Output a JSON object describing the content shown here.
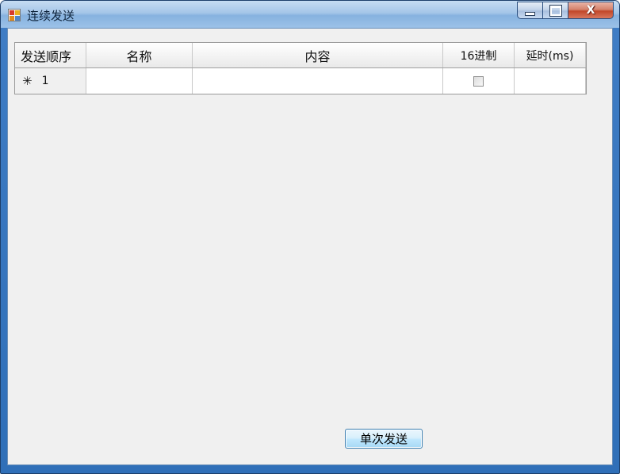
{
  "window": {
    "title": "连续发送"
  },
  "grid": {
    "columns": [
      "发送顺序",
      "名称",
      "内容",
      "16进制",
      "延时(ms)"
    ],
    "rows": [
      {
        "marker": "✳",
        "index": "1",
        "name": "",
        "content": "",
        "hex": false,
        "delay": ""
      }
    ]
  },
  "actions": {
    "single_send_label": "单次发送"
  },
  "colors": {
    "title_bar": "#a4c5e8",
    "client_bg": "#f0f0f0",
    "close_button": "#c2472a",
    "button_border": "#3c7fb1"
  }
}
